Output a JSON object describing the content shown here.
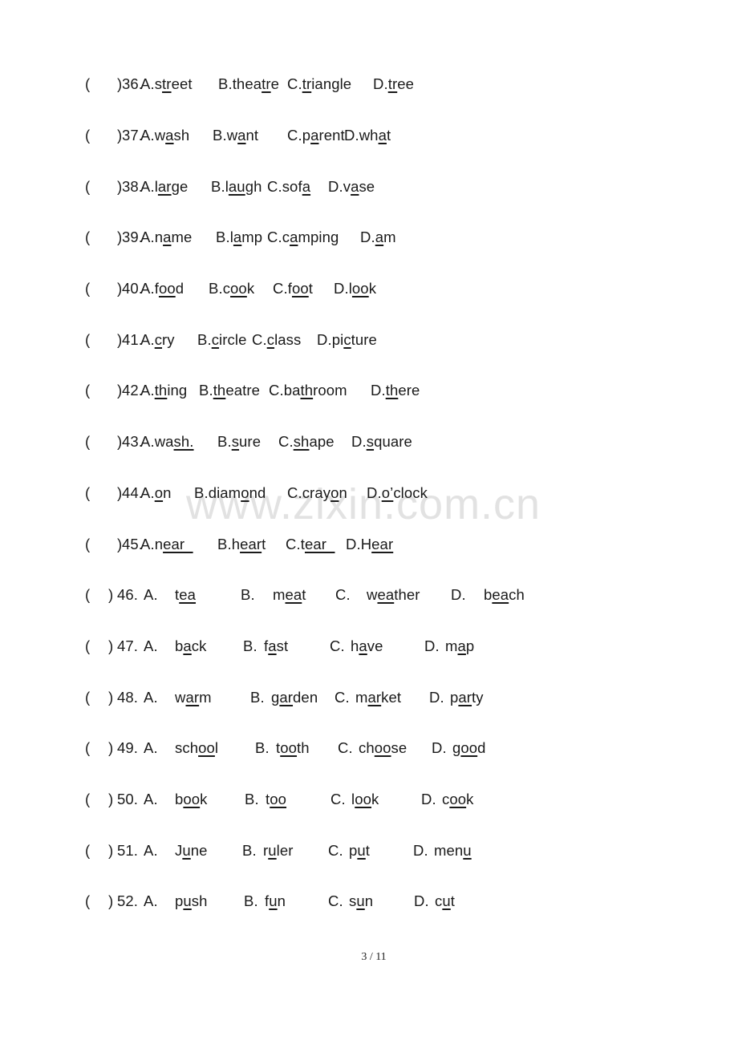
{
  "watermark": "www.zixin.com.cn",
  "footer": {
    "page_indicator": "3  / 11"
  },
  "questions": [
    {
      "num": "36",
      "style": "compact",
      "options": [
        {
          "letter": "A",
          "pre": "s",
          "u": "tr",
          "post": "eet"
        },
        {
          "letter": "B",
          "pre": "thea",
          "u": "tr",
          "post": "e"
        },
        {
          "letter": "C",
          "pre": "",
          "u": "tr",
          "post": "iangle"
        },
        {
          "letter": "D",
          "pre": "",
          "u": "tr",
          "post": "ee"
        }
      ]
    },
    {
      "num": "37",
      "style": "compact",
      "options": [
        {
          "letter": "A",
          "pre": "w",
          "u": "a",
          "post": "sh"
        },
        {
          "letter": "B",
          "pre": "w",
          "u": "a",
          "post": "nt"
        },
        {
          "letter": "C",
          "pre": "p",
          "u": "a",
          "post": "rent"
        },
        {
          "letter": "D",
          "pre": "wh",
          "u": "a",
          "post": "t"
        }
      ]
    },
    {
      "num": "38",
      "style": "compact",
      "options": [
        {
          "letter": "A",
          "pre": "l",
          "u": "ar",
          "post": "ge"
        },
        {
          "letter": "B",
          "pre": "l",
          "u": "au",
          "post": "gh"
        },
        {
          "letter": "C",
          "pre": "sof",
          "u": "a",
          "post": ""
        },
        {
          "letter": "D",
          "pre": "v",
          "u": "a",
          "post": "se"
        }
      ]
    },
    {
      "num": "39",
      "style": "compact",
      "options": [
        {
          "letter": "A",
          "pre": "n",
          "u": "a",
          "post": "me"
        },
        {
          "letter": "B",
          "pre": "l",
          "u": "a",
          "post": "mp"
        },
        {
          "letter": "C",
          "pre": "c",
          "u": "a",
          "post": "mping"
        },
        {
          "letter": "D",
          "pre": "",
          "u": "a",
          "post": "m"
        }
      ]
    },
    {
      "num": "40",
      "style": "compact",
      "options": [
        {
          "letter": "A",
          "pre": "f",
          "u": "oo",
          "post": "d"
        },
        {
          "letter": "B",
          "pre": "c",
          "u": "oo",
          "post": "k"
        },
        {
          "letter": "C",
          "pre": "f",
          "u": "oo",
          "post": "t"
        },
        {
          "letter": "D",
          "pre": "l",
          "u": "oo",
          "post": "k"
        }
      ]
    },
    {
      "num": "41",
      "style": "compact",
      "options": [
        {
          "letter": "A",
          "pre": "",
          "u": "c",
          "post": "ry"
        },
        {
          "letter": "B",
          "pre": "",
          "u": "c",
          "post": "ircle"
        },
        {
          "letter": "C",
          "pre": "",
          "u": "c",
          "post": "lass"
        },
        {
          "letter": "D",
          "pre": "pi",
          "u": "c",
          "post": "ture"
        }
      ]
    },
    {
      "num": "42",
      "style": "compact",
      "options": [
        {
          "letter": "A",
          "pre": "",
          "u": "th",
          "post": "ing"
        },
        {
          "letter": "B",
          "pre": "",
          "u": "th",
          "post": "eatre"
        },
        {
          "letter": "C",
          "pre": "ba",
          "u": "th",
          "post": "room"
        },
        {
          "letter": "D",
          "pre": "",
          "u": "th",
          "post": "ere"
        }
      ]
    },
    {
      "num": "43",
      "style": "compact",
      "options": [
        {
          "letter": "A",
          "pre": "wa",
          "u": "sh.",
          "post": ""
        },
        {
          "letter": "B",
          "pre": "",
          "u": "s",
          "post": "ure"
        },
        {
          "letter": "C",
          "pre": "",
          "u": "sh",
          "post": "ape"
        },
        {
          "letter": "D",
          "pre": "",
          "u": "s",
          "post": "quare"
        }
      ]
    },
    {
      "num": "44",
      "style": "compact",
      "options": [
        {
          "letter": "A",
          "pre": "",
          "u": "o",
          "post": "n"
        },
        {
          "letter": "B",
          "pre": "diam",
          "u": "o",
          "post": "nd"
        },
        {
          "letter": "C",
          "pre": "cray",
          "u": "o",
          "post": "n"
        },
        {
          "letter": "D",
          "pre": "",
          "u": "o’",
          "post": "clock"
        }
      ]
    },
    {
      "num": "45",
      "style": "compact",
      "options": [
        {
          "letter": "A",
          "pre": "n",
          "u": "ear  ",
          "post": ""
        },
        {
          "letter": "B",
          "pre": "h",
          "u": "ear",
          "post": "t"
        },
        {
          "letter": "C",
          "pre": "t",
          "u": "ear  ",
          "post": ""
        },
        {
          "letter": "D",
          "pre": "H",
          "u": "ear",
          "post": ""
        }
      ]
    },
    {
      "num": "46",
      "style": "spaced",
      "options": [
        {
          "letter": "A",
          "pre": "t",
          "u": "ea",
          "post": ""
        },
        {
          "letter": "B",
          "pre": "m",
          "u": "ea",
          "post": "t"
        },
        {
          "letter": "C",
          "pre": "w",
          "u": "ea",
          "post": "ther"
        },
        {
          "letter": "D",
          "pre": "b",
          "u": "ea",
          "post": "ch"
        }
      ]
    },
    {
      "num": "47",
      "style": "spaced",
      "options": [
        {
          "letter": "A",
          "pre": "b",
          "u": "a",
          "post": "ck"
        },
        {
          "letter": "B",
          "pre": "f",
          "u": "a",
          "post": "st"
        },
        {
          "letter": "C",
          "pre": "h",
          "u": "a",
          "post": "ve"
        },
        {
          "letter": "D",
          "pre": "m",
          "u": "a",
          "post": "p"
        }
      ]
    },
    {
      "num": "48",
      "style": "spaced",
      "options": [
        {
          "letter": "A",
          "pre": "w",
          "u": "ar",
          "post": "m"
        },
        {
          "letter": "B",
          "pre": "g",
          "u": "ar",
          "post": "den"
        },
        {
          "letter": "C",
          "pre": "m",
          "u": "ar",
          "post": "ket"
        },
        {
          "letter": "D",
          "pre": "p",
          "u": "ar",
          "post": "ty"
        }
      ]
    },
    {
      "num": "49",
      "style": "spaced",
      "options": [
        {
          "letter": "A",
          "pre": "sch",
          "u": "oo",
          "post": "l"
        },
        {
          "letter": "B",
          "pre": "t",
          "u": "oo",
          "post": "th"
        },
        {
          "letter": "C",
          "pre": "ch",
          "u": "oo",
          "post": "se"
        },
        {
          "letter": "D",
          "pre": "g",
          "u": "oo",
          "post": "d"
        }
      ]
    },
    {
      "num": "50",
      "style": "spaced",
      "options": [
        {
          "letter": "A",
          "pre": "b",
          "u": "oo",
          "post": "k"
        },
        {
          "letter": "B",
          "pre": "t",
          "u": "oo",
          "post": ""
        },
        {
          "letter": "C",
          "pre": "l",
          "u": "oo",
          "post": "k"
        },
        {
          "letter": "D",
          "pre": "c",
          "u": "oo",
          "post": "k"
        }
      ]
    },
    {
      "num": "51",
      "style": "spaced",
      "options": [
        {
          "letter": "A",
          "pre": "J",
          "u": "u",
          "post": "ne"
        },
        {
          "letter": "B",
          "pre": "r",
          "u": "u",
          "post": "ler"
        },
        {
          "letter": "C",
          "pre": "p",
          "u": "u",
          "post": "t"
        },
        {
          "letter": "D",
          "pre": "men",
          "u": "u",
          "post": ""
        }
      ]
    },
    {
      "num": "52",
      "style": "spaced",
      "options": [
        {
          "letter": "A",
          "pre": "p",
          "u": "u",
          "post": "sh"
        },
        {
          "letter": "B",
          "pre": "f",
          "u": "u",
          "post": "n"
        },
        {
          "letter": "C",
          "pre": "s",
          "u": "u",
          "post": "n"
        },
        {
          "letter": "D",
          "pre": "c",
          "u": "u",
          "post": "t"
        }
      ]
    }
  ]
}
